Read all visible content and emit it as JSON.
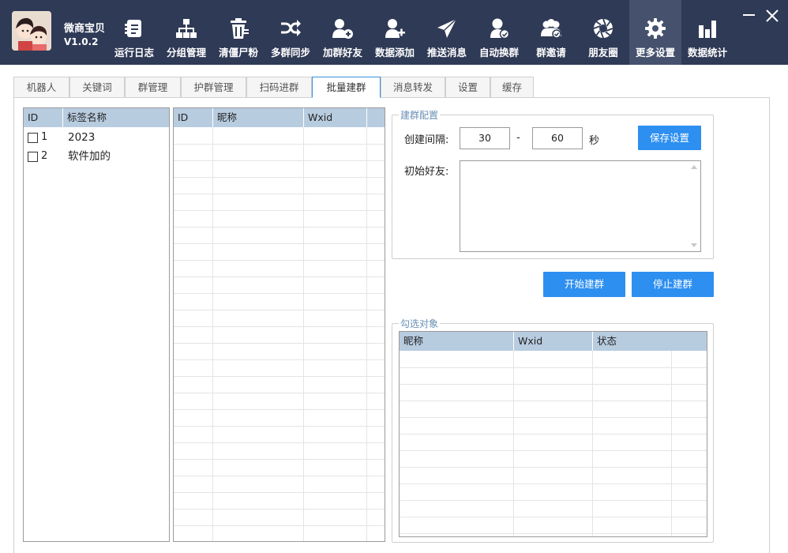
{
  "app": {
    "name": "微商宝贝",
    "version": "V1.0.2"
  },
  "toolbar": [
    {
      "label": "运行日志",
      "icon": "log-icon"
    },
    {
      "label": "分组管理",
      "icon": "org-chart-icon"
    },
    {
      "label": "清僵尸粉",
      "icon": "trash-icon"
    },
    {
      "label": "多群同步",
      "icon": "shuffle-icon"
    },
    {
      "label": "加群好友",
      "icon": "add-group-friend-icon"
    },
    {
      "label": "数据添加",
      "icon": "add-user-icon"
    },
    {
      "label": "推送消息",
      "icon": "send-icon"
    },
    {
      "label": "自动换群",
      "icon": "user-switch-icon"
    },
    {
      "label": "群邀请",
      "icon": "group-invite-icon"
    },
    {
      "label": "朋友圈",
      "icon": "aperture-icon"
    },
    {
      "label": "更多设置",
      "icon": "gear-icon"
    },
    {
      "label": "数据统计",
      "icon": "bar-chart-icon"
    }
  ],
  "active_tool": "更多设置",
  "tabs": [
    "机器人",
    "关键词",
    "群管理",
    "护群管理",
    "扫码进群",
    "批量建群",
    "消息转发",
    "设置",
    "缓存"
  ],
  "active_tab": "批量建群",
  "tags_table": {
    "columns": [
      "ID",
      "标签名称"
    ],
    "rows": [
      {
        "id": "1",
        "name": "2023",
        "checked": false
      },
      {
        "id": "2",
        "name": "软件加的",
        "checked": false
      }
    ]
  },
  "friends_table": {
    "columns": [
      "ID",
      "昵称",
      "Wxid"
    ]
  },
  "config": {
    "legend": "建群配置",
    "interval_label": "创建间隔:",
    "interval_min": "30",
    "interval_sep": "-",
    "interval_max": "60",
    "interval_unit": "秒",
    "save_label": "保存设置",
    "initial_friends_label": "初始好友:",
    "initial_friends_value": ""
  },
  "actions": {
    "start_label": "开始建群",
    "stop_label": "停止建群"
  },
  "selected": {
    "legend": "勾选对象",
    "columns": [
      "昵称",
      "Wxid",
      "状态"
    ]
  },
  "colors": {
    "topbar": "#2f3a56",
    "active_tool": "#46516d",
    "header": "#b8cce0",
    "button": "#2d8ff0"
  }
}
